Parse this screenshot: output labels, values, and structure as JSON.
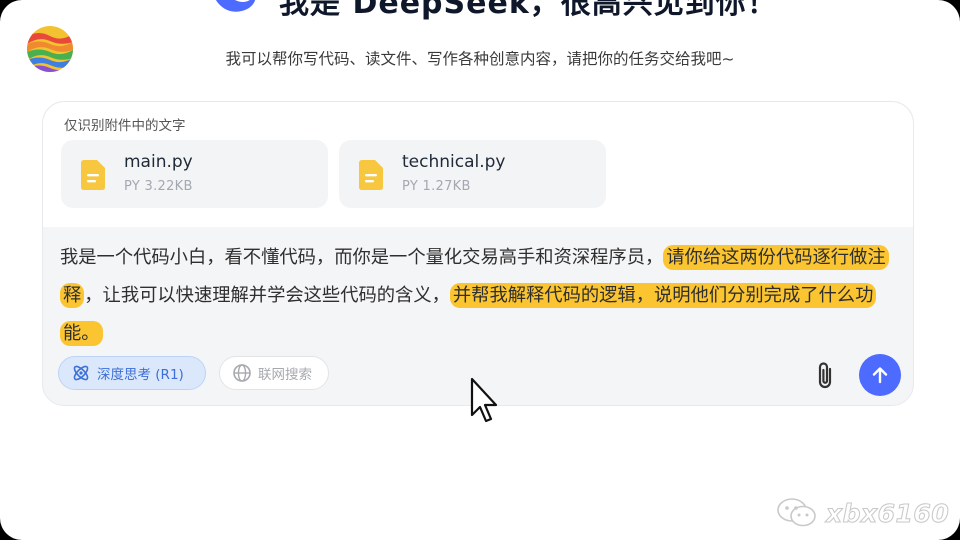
{
  "header": {
    "title": "我是 DeepSeek，很高兴见到你！",
    "subtitle": "我可以帮你写代码、读文件、写作各种创意内容，请把你的任务交给我吧~",
    "logo_icon": "deepseek-whale-icon",
    "avatar_icon": "rainbow-avatar"
  },
  "attachments": {
    "note": "仅识别附件中的文字",
    "files": [
      {
        "name": "main.py",
        "meta": "PY 3.22KB",
        "icon": "document-icon"
      },
      {
        "name": "technical.py",
        "meta": "PY 1.27KB",
        "icon": "document-icon"
      }
    ]
  },
  "prompt": {
    "part1": "我是一个代码小白，看不懂代码，而你是一个量化交易高手和资深程序员，",
    "highlight1": "请你给这两份代码逐行做注释",
    "part2": "，让我可以快速理解并学会这些代码的含义，",
    "highlight2": "并帮我解释代码的逻辑，说明他们分别完成了什么功能。",
    "highlight_color": "#fbc531"
  },
  "toolbar": {
    "deep_think_label": "深度思考 (R1)",
    "web_search_label": "联网搜索",
    "attach_icon": "paperclip-icon",
    "send_icon": "arrow-up-icon",
    "accent_color": "#4d6bfe"
  },
  "watermark": {
    "text": "xbx6160",
    "icon": "wechat-icon"
  }
}
